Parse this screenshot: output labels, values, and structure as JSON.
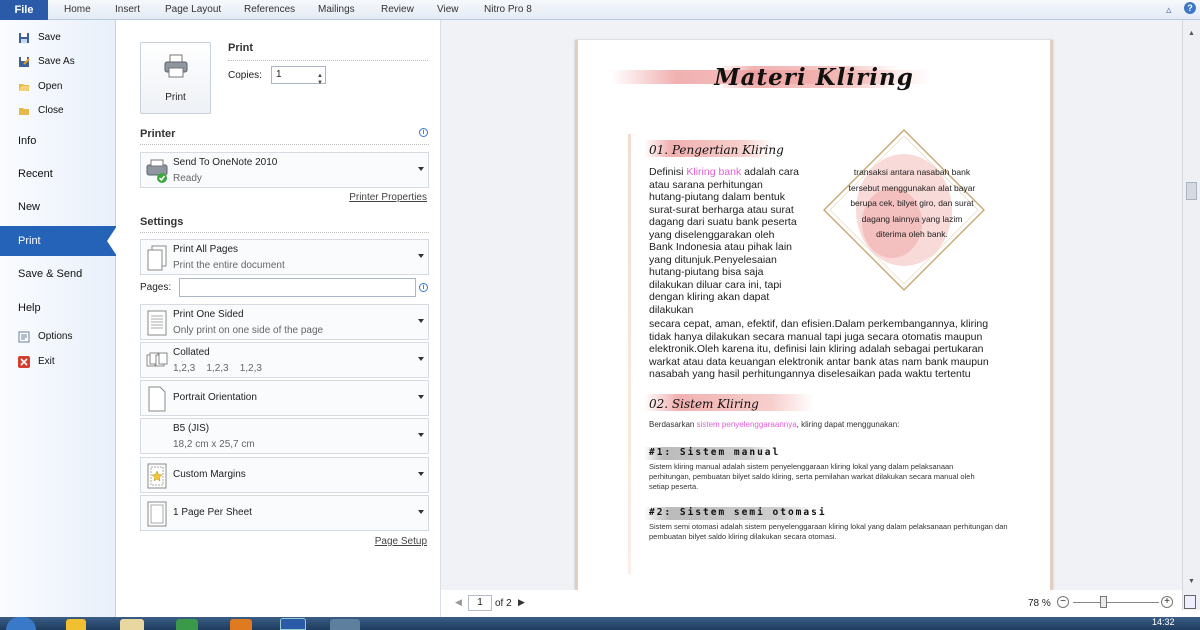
{
  "ribbon": {
    "file_tab": "File",
    "tabs": [
      "Home",
      "Insert",
      "Page Layout",
      "References",
      "Mailings",
      "Review",
      "View",
      "Nitro Pro 8"
    ]
  },
  "nav": {
    "save": "Save",
    "save_as": "Save As",
    "open": "Open",
    "close": "Close",
    "info": "Info",
    "recent": "Recent",
    "new": "New",
    "print": "Print",
    "save_send": "Save & Send",
    "help": "Help",
    "options": "Options",
    "exit": "Exit"
  },
  "print": {
    "button_label": "Print",
    "section_title": "Print",
    "copies_label": "Copies:",
    "copies_value": "1",
    "printer_title": "Printer",
    "printer_name": "Send To OneNote 2010",
    "printer_status": "Ready",
    "printer_properties": "Printer Properties",
    "settings_title": "Settings",
    "pages_label": "Pages:",
    "pages_value": "",
    "page_setup": "Page Setup",
    "settings": [
      {
        "main": "Print All Pages",
        "sub": "Print the entire document"
      },
      {
        "main": "Print One Sided",
        "sub": "Only print on one side of the page"
      },
      {
        "main": "Collated",
        "sub": "1,2,3    1,2,3    1,2,3"
      },
      {
        "main": "Portrait Orientation",
        "sub": ""
      },
      {
        "main": "B5 (JIS)",
        "sub": "18,2 cm x 25,7 cm"
      },
      {
        "main": "Custom Margins",
        "sub": ""
      },
      {
        "main": "1 Page Per Sheet",
        "sub": ""
      }
    ]
  },
  "document": {
    "title": "Materi Kliring",
    "h1": "01. Pengertian Kliring",
    "p1_prefix": "Definisi ",
    "p1_highlight": "Kliring bank",
    "p1_rest": " adalah cara atau sarana perhitungan hutang-piutang dalam bentuk surat-surat berharga atau surat dagang dari suatu bank peserta yang diselenggarakan oleh Bank Indonesia atau pihak lain yang ditunjuk.Penyelesaian hutang-piutang bisa saja dilakukan diluar cara ini, tapi dengan kliring akan dapat dilakukan",
    "p1_wide": "secara cepat, aman, efektif, dan efisien.Dalam perkembangannya, kliring tidak hanya dilakukan secara manual tapi juga secara otomatis maupun elektronik.Oleh karena itu, definisi lain kliring adalah sebagai pertukaran warkat atau data keuangan elektronik antar bank atas nam bank maupun nasabah yang hasil perhitungannya diselesaikan pada waktu tertentu",
    "diamond": "transaksi antara nasabah bank tersebut menggunakan alat bayar berupa cek, bilyet giro, dan surat dagang lainnya yang lazim diterima oleh bank.",
    "h2": "02. Sistem Kliring",
    "p2_prefix": "Berdasarkan ",
    "p2_highlight": "sistem penyelenggaraannya",
    "p2_rest": ",  kliring dapat menggunakan:",
    "sub1": "#1: Sistem manual",
    "sub1_text": "Sistem kliring manual adalah sistem penyelenggaraan kliring lokal yang dalam pelaksanaan perhitungan, pembuatan bilyet saldo kliring, serta pemilahan warkat dilakukan secara manual oleh setiap peserta.",
    "sub2": "#2: Sistem semi otomasi",
    "sub2_text": "Sistem semi otomasi  adalah sistem penyelenggaraan kliring  lokal yang dalam pelaksanaan perhitungan dan pembuatan bilyet saldo kliring  dilakukan secara otomasi."
  },
  "pager": {
    "current_page": "1",
    "of_label": "of 2",
    "zoom": "78 %"
  },
  "taskbar": {
    "clock": "14:32"
  },
  "colors": {
    "file_tab": "#2a5aa8",
    "nav_active": "#2563b8",
    "highlight_pink": "#e25fd7",
    "brush_pink": "#ec9696"
  }
}
